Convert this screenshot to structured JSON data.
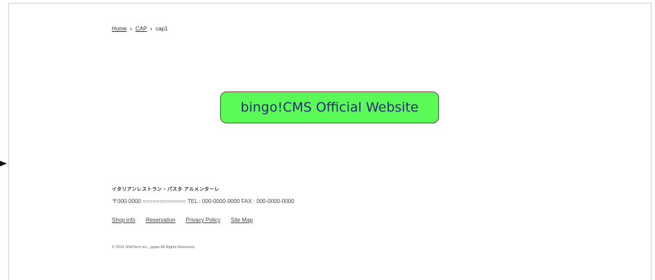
{
  "breadcrumb": {
    "home": "Home",
    "separator": "›",
    "cap": "CAP",
    "current": "cap1"
  },
  "cta": {
    "label": "bingo!CMS Official Website"
  },
  "footer": {
    "shop_name": "イタリアンレストラン・パスタ アルメンターレ",
    "address": "〒000-0000 ○○○○○○○○○○○○○ TEL : 000-0000-0000 FAX : 000-0000-0000",
    "links": [
      "Shop info",
      "Reservation",
      "Privacy Policy",
      "Site Map"
    ],
    "copyright": "© 2014 ShiftTech Inc., japan All Rights Reserved."
  },
  "colors": {
    "button_bg": "#5bfb57",
    "button_text": "#2e2a7c",
    "button_border": "#7a3b4a"
  }
}
